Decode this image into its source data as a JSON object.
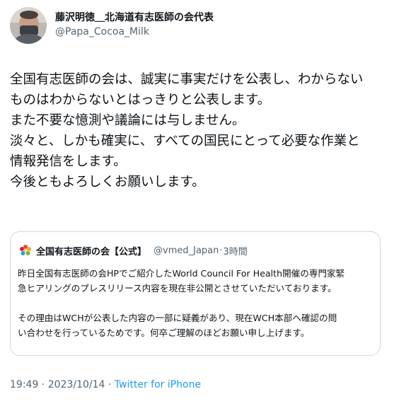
{
  "author": {
    "display_name": "藤沢明徳＿北海道有志医師の会代表",
    "handle": "@Papa_Cocoa_Milk"
  },
  "body_lines": [
    "全国有志医師の会は、誠実に事実だけを公表し、わからない",
    "ものはわからないとはっきりと公表します。",
    "また不要な憶測や議論には与しません。",
    "淡々と、しかも確実に、すべての国民にとって必要な作業と",
    "情報発信をします。",
    "今後ともよろしくお願いします。"
  ],
  "quote": {
    "name": "全国有志医師の会【公式】",
    "handle": "@vmed_Japan",
    "separator": "·",
    "time": "3時間",
    "para1": [
      "昨日全国有志医師の会HPでご紹介したWorld Council For Health開催の専門家緊",
      "急ヒアリングのプレスリリース内容を現在非公開とさせていただいております。"
    ],
    "para2": [
      "その理由はWCHが公表した内容の一部に疑義があり、現在WCH本部へ確認の問",
      "い合わせを行っているためです。何卒ご理解のほどお願い申し上げます。"
    ]
  },
  "meta": {
    "time": "19:49",
    "separator1": " · ",
    "date": "2023/10/14",
    "separator2": " · ",
    "source": "Twitter for iPhone"
  },
  "colors": {
    "text": "#0f1419",
    "secondary": "#536471",
    "link": "#1d9bf0",
    "border": "#cfd9de"
  },
  "icons": {
    "avatar": "profile-photo",
    "quote_logo": "flower-logo"
  }
}
